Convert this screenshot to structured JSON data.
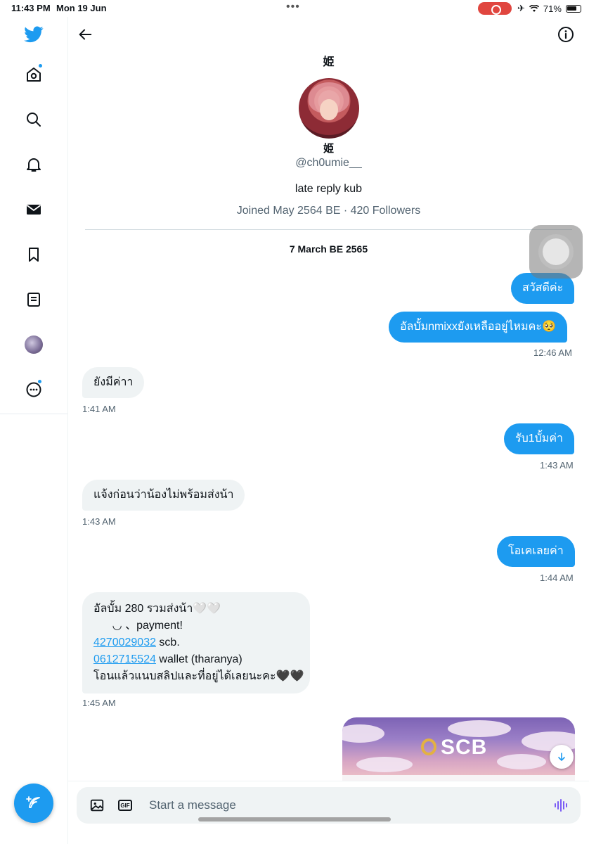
{
  "status_bar": {
    "time": "11:43 PM",
    "date": "Mon 19 Jun",
    "battery": "71%"
  },
  "sidebar": {
    "items": [
      {
        "name": "twitter-logo-icon"
      },
      {
        "name": "home-icon",
        "notification_dot": true
      },
      {
        "name": "search-icon"
      },
      {
        "name": "notifications-icon"
      },
      {
        "name": "messages-icon"
      },
      {
        "name": "bookmarks-icon"
      },
      {
        "name": "lists-icon"
      },
      {
        "name": "profile-avatar"
      },
      {
        "name": "more-icon",
        "notification_dot": true
      }
    ],
    "compose_icon": "compose-tweet-icon"
  },
  "conversation": {
    "profile": {
      "display_name": "姫",
      "handle": "@ch0umie__",
      "bio": "late reply kub",
      "joined": "Joined May 2564 BE · 420 Followers"
    },
    "date_separator": "7 March BE 2565",
    "messages": [
      {
        "direction": "out",
        "text": "สวัสดีค่ะ"
      },
      {
        "direction": "out",
        "text": "อัลบั้มnmixxยังเหลืออยู่ไหมคะ🥺",
        "time": "12:46 AM"
      },
      {
        "direction": "in",
        "text": "ยังมีค่าา",
        "time": "1:41 AM"
      },
      {
        "direction": "out",
        "text": "รับ1บั้มค่า",
        "time": "1:43 AM"
      },
      {
        "direction": "in",
        "text": "แจ้งก่อนว่าน้องไม่พร้อมส่งน้า",
        "time": "1:43 AM"
      },
      {
        "direction": "out",
        "text": "โอเคเลยค่า",
        "time": "1:44 AM"
      },
      {
        "direction": "in",
        "lines": {
          "l1": "อัลบั้ม 280 รวมส่งน้า🤍🤍",
          "l2": "      ◡ 、payment!",
          "account_number": "4270029032",
          "account_suffix": " scb.",
          "wallet_number": "0612715524",
          "wallet_suffix": " wallet (tharanya)",
          "l5": "โอนแล้วแนบสลิปและที่อยู่ได้เลยนะคะ🖤🖤"
        },
        "time": "1:45 AM"
      }
    ],
    "image_attachment": {
      "brand_text": "SCB"
    }
  },
  "composer": {
    "placeholder": "Start a message",
    "gif_label": "GIF"
  },
  "colors": {
    "accent": "#1d9bf0",
    "incoming_bubble": "#eff3f4",
    "recording_pill": "#e0463f"
  }
}
